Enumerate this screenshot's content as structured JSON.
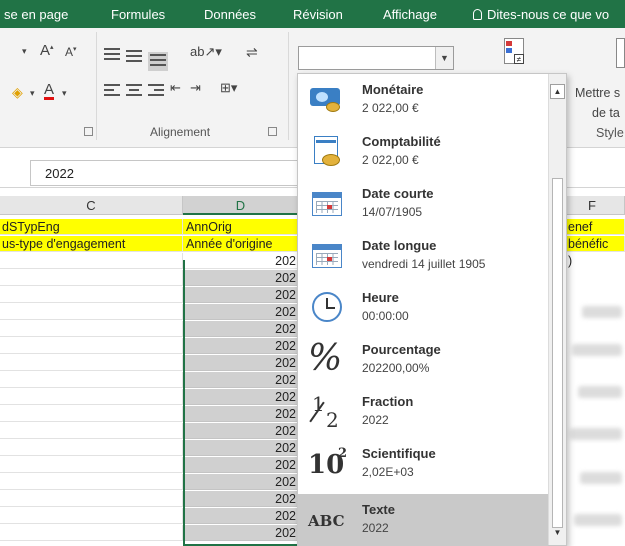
{
  "ribbon_tabs": [
    "se en page",
    "Formules",
    "Données",
    "Révision",
    "Affichage",
    "Dites-nous ce que vo"
  ],
  "ribbon": {
    "font_grow": "A",
    "font_shrink": "A",
    "font_color": "A",
    "alignment_group": "Alignement",
    "style_group": "Style",
    "cond_format_label_1": "Mettre s",
    "cond_format_label_2": "de ta",
    "number_format_value": ""
  },
  "formula_bar": {
    "value": "2022"
  },
  "columns": [
    "C",
    "D",
    "F"
  ],
  "header_row_1": {
    "c": "dSTypEng",
    "d": "AnnOrig",
    "f": "enef"
  },
  "header_row_2": {
    "c": "us-type d'engagement",
    "d": "Année d'origine",
    "f": "bénéfic"
  },
  "d_values": [
    "202",
    "202",
    "202",
    "202",
    "202",
    "202",
    "202",
    "202",
    "202",
    "202",
    "202",
    "202",
    "202",
    "202",
    "202",
    "202",
    "202"
  ],
  "f_value": ")",
  "number_formats": [
    {
      "title": "Monétaire",
      "value": "2 022,00 €",
      "icon": "currency-icon"
    },
    {
      "title": "Comptabilité",
      "value": "2 022,00 €",
      "icon": "accounting-icon"
    },
    {
      "title": "Date courte",
      "value": "14/07/1905",
      "icon": "calendar-icon"
    },
    {
      "title": "Date longue",
      "value": "vendredi 14 juillet 1905",
      "icon": "calendar-icon"
    },
    {
      "title": "Heure",
      "value": "00:00:00",
      "icon": "clock-icon"
    },
    {
      "title": "Pourcentage",
      "value": "202200,00%",
      "icon": "percent-icon",
      "glyph": "%"
    },
    {
      "title": "Fraction",
      "value": "2022",
      "icon": "fraction-icon",
      "glyph_num": "1",
      "glyph_den": "2"
    },
    {
      "title": "Scientifique",
      "value": "2,02E+03",
      "icon": "scientific-icon",
      "glyph_base": "10",
      "glyph_exp": "2"
    },
    {
      "title": "Texte",
      "value": "2022",
      "icon": "text-format-icon",
      "glyph": "ABC"
    }
  ],
  "colors": {
    "excel_green": "#217346",
    "header_yellow": "#ffff00",
    "selected_item": "#c9c9c9"
  }
}
